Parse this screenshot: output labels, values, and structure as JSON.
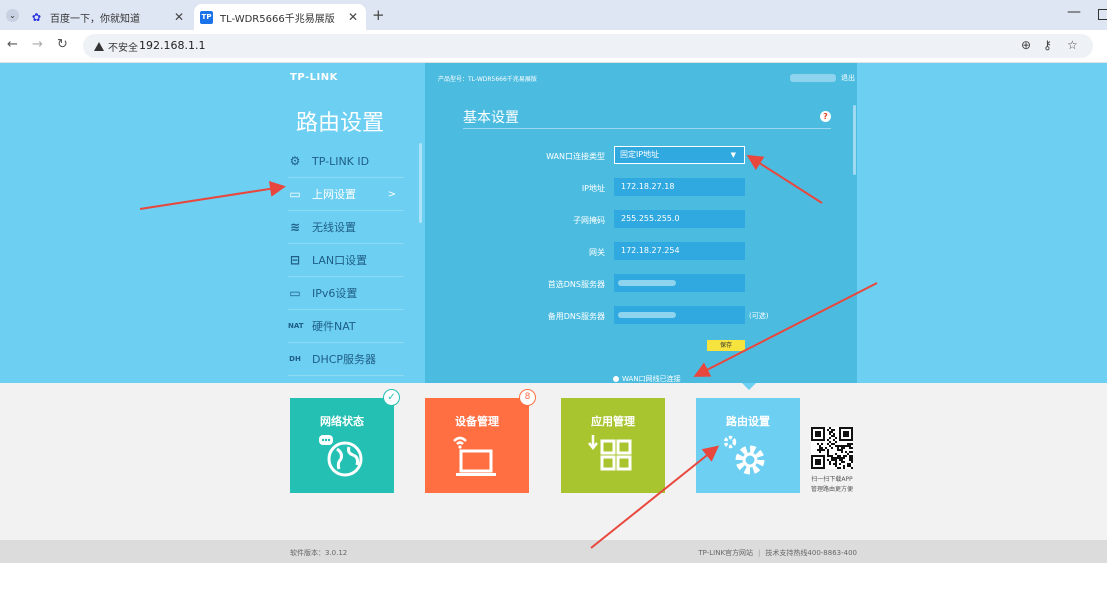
{
  "browser": {
    "tabs": [
      {
        "title": "百度一下，你就知道",
        "icon": "baidu-paw-icon",
        "icon_color": "#2932e1"
      },
      {
        "title": "TL-WDR5666千兆易展版",
        "icon": "tplink-favicon",
        "icon_color": "#1a73e8",
        "icon_text": "TP",
        "active": true
      }
    ],
    "new_tab_symbol": "+",
    "close_symbol": "✕",
    "security_label": "不安全",
    "url": "192.168.1.1"
  },
  "router": {
    "logo": "TP-LINK",
    "model": "产品型号：TL-WDR5666千兆易展版",
    "logout": "退出",
    "panel_title": "路由设置",
    "menu": [
      {
        "label": "TP-LINK ID",
        "icon": "gear-icon",
        "glyph": "⚙",
        "active": false
      },
      {
        "label": "上网设置",
        "icon": "laptop-icon",
        "glyph": "▭",
        "active": true
      },
      {
        "label": "无线设置",
        "icon": "wifi-icon",
        "glyph": "≋",
        "active": false
      },
      {
        "label": "LAN口设置",
        "icon": "lan-port-icon",
        "glyph": "⊟",
        "active": false
      },
      {
        "label": "IPv6设置",
        "icon": "laptop-icon",
        "glyph": "▭",
        "active": false
      },
      {
        "label": "硬件NAT",
        "icon": "nat-icon",
        "glyph": "NAT",
        "active": false
      },
      {
        "label": "DHCP服务器",
        "icon": "dhcp-icon",
        "glyph": "DH",
        "active": false
      }
    ],
    "menu_arrow": ">",
    "section_title": "基本设置",
    "help_symbol": "?",
    "form": {
      "wan_type_label": "WAN口连接类型",
      "wan_type_value": "固定IP地址",
      "ip_label": "IP地址",
      "ip_value": "172.18.27.18",
      "mask_label": "子网掩码",
      "mask_value": "255.255.255.0",
      "gateway_label": "网关",
      "gateway_value": "172.18.27.254",
      "dns1_label": "首选DNS服务器",
      "dns2_label": "备用DNS服务器",
      "optional_note": "(可选)",
      "save_label": "保存",
      "wan_status": "WAN口网线已连接"
    },
    "tiles": [
      {
        "label": "网络状态",
        "color": "#23c0b3"
      },
      {
        "label": "设备管理",
        "color": "#ff6f42",
        "badge": "8"
      },
      {
        "label": "应用管理",
        "color": "#a8c530"
      },
      {
        "label": "路由设置",
        "color": "#6dcff1"
      }
    ],
    "qr_caption_line1": "扫一扫下载APP",
    "qr_caption_line2": "管理路由更方便",
    "version": "软件版本：3.0.12",
    "footer_link1": "TP-LINK官方网站",
    "footer_link2": "技术支持热线400-8863-400"
  },
  "colors": {
    "top_bg": "#6dcff1",
    "content_bg": "#4bbce0",
    "input_bg": "#2fa9df",
    "save_btn": "#f7e33d",
    "annotation_arrow": "#e8473d"
  }
}
